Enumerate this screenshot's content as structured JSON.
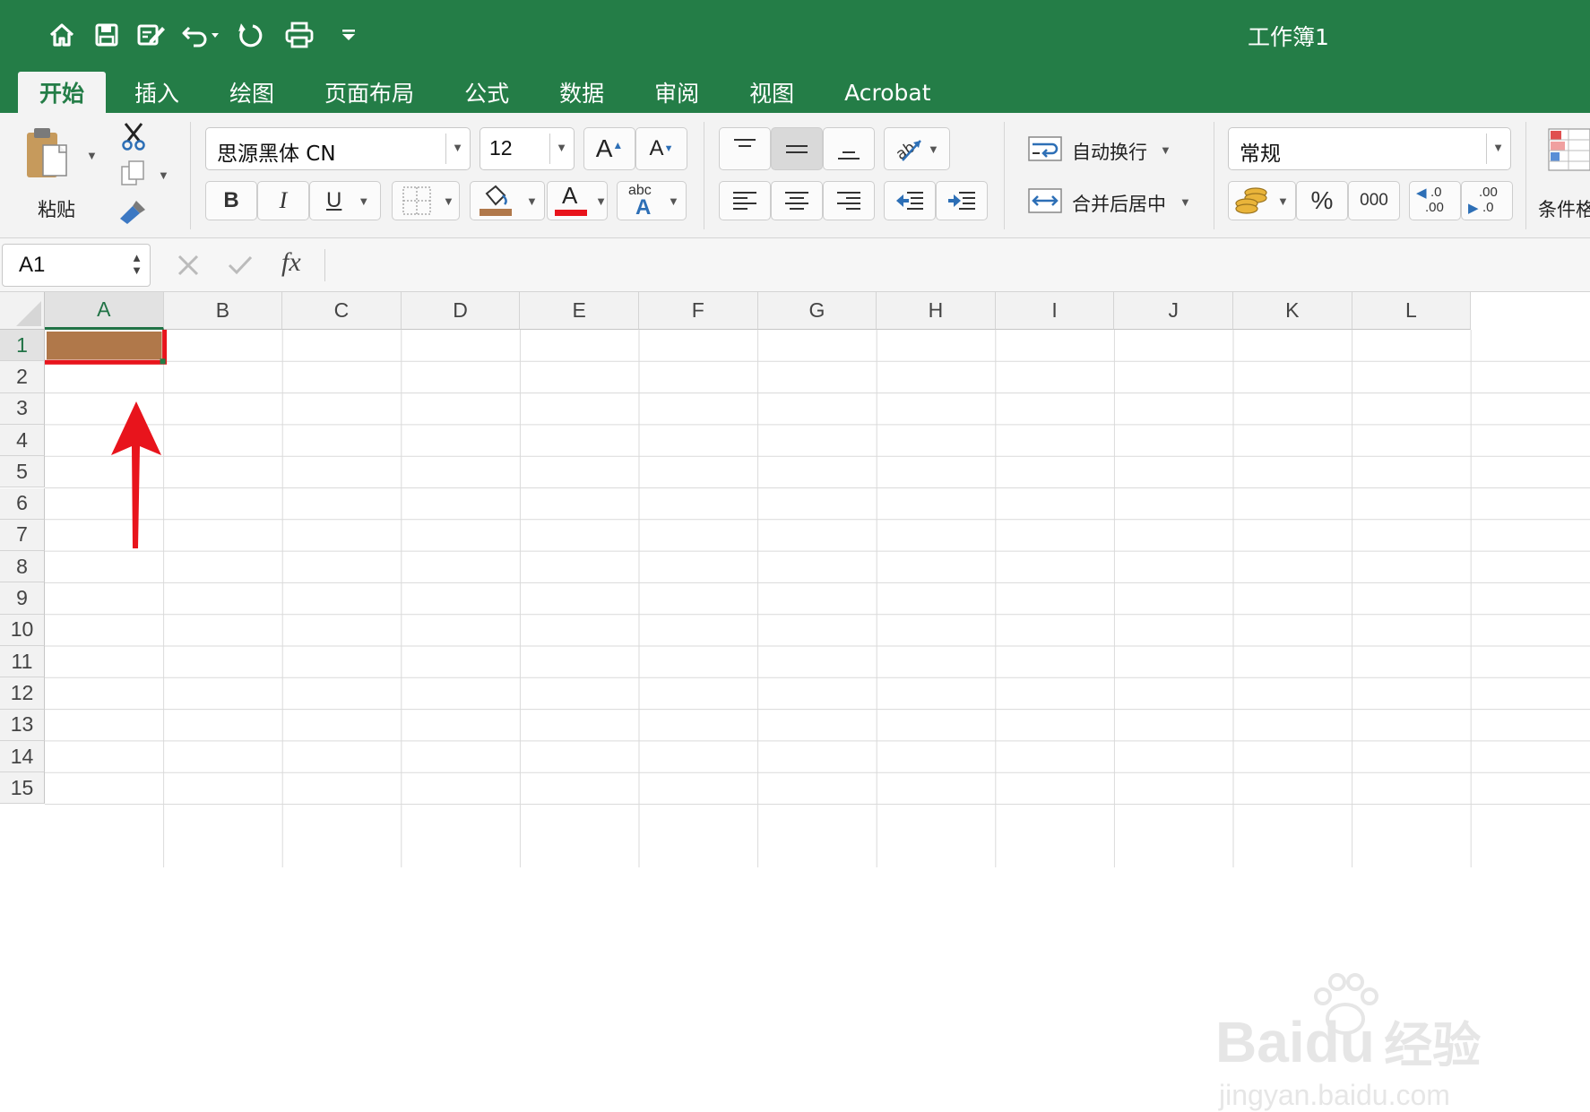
{
  "window": {
    "title": "工作簿1"
  },
  "qat": {
    "icons": [
      "home-icon",
      "save-icon",
      "edit-icon",
      "undo-icon",
      "redo-icon",
      "print-icon",
      "customize-icon"
    ]
  },
  "tabs": [
    "开始",
    "插入",
    "绘图",
    "页面布局",
    "公式",
    "数据",
    "审阅",
    "视图",
    "Acrobat"
  ],
  "active_tab": "开始",
  "ribbon": {
    "paste_label": "粘贴",
    "font_name": "思源黑体 CN",
    "font_size": "12",
    "bold": "B",
    "italic": "I",
    "underline": "U",
    "font_color_letter": "A",
    "phonetic_top": "abc",
    "phonetic_bottom": "A",
    "wrap_text": "自动换行",
    "merge_center": "合并后居中",
    "number_format": "常规",
    "percent": "%",
    "comma": "000",
    "dec_inc_top": ".0",
    "dec_inc_bottom": ".00",
    "dec_dec_top": ".00",
    "dec_dec_bottom": ".0",
    "conditional_format": "条件格",
    "grow_font": "A",
    "shrink_font": "A",
    "colors": {
      "fill": "#b0784a",
      "font": "#e8141c",
      "accent": "#247d47"
    }
  },
  "formula_bar": {
    "name_box": "A1",
    "fx": "fx",
    "value": ""
  },
  "sheet": {
    "columns": [
      "A",
      "B",
      "C",
      "D",
      "E",
      "F",
      "G",
      "H",
      "I",
      "J",
      "K",
      "L"
    ],
    "rows": [
      "1",
      "2",
      "3",
      "4",
      "5",
      "6",
      "7",
      "8",
      "9",
      "10",
      "11",
      "12",
      "13",
      "14",
      "15"
    ],
    "selected_cell": "A1",
    "selected_fill": "#b0784a",
    "annotation_color": "#e8141c"
  },
  "watermark": {
    "brand": "Baidu",
    "cn": "经验",
    "url": "jingyan.baidu.com"
  }
}
